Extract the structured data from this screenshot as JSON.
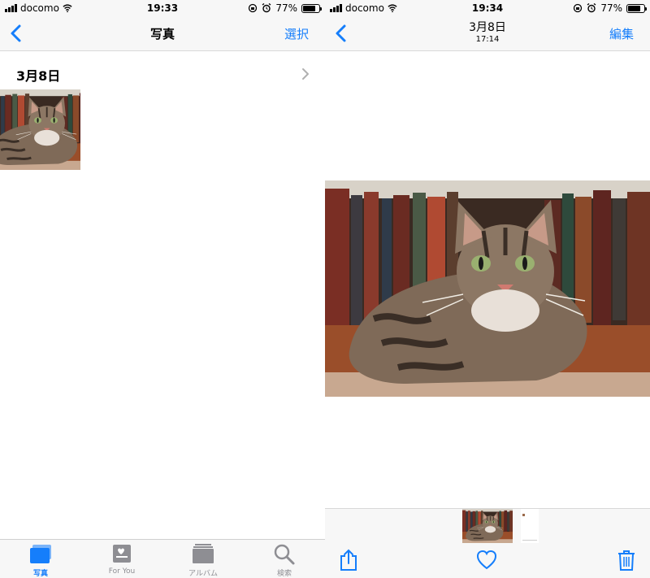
{
  "colors": {
    "accent": "#157efb",
    "bar_bg": "#f7f7f7",
    "inactive": "#8e8e93"
  },
  "left": {
    "status": {
      "carrier": "docomo",
      "time": "19:33",
      "battery": "77%",
      "battery_level": 0.77
    },
    "nav": {
      "back_icon": "chevron-left-icon",
      "title": "写真",
      "action": "選択"
    },
    "section": {
      "date": "3月8日",
      "chevron_icon": "chevron-right-icon"
    },
    "tabs": [
      {
        "label": "写真",
        "icon": "photos-icon",
        "active": true
      },
      {
        "label": "For You",
        "icon": "for-you-icon",
        "active": false
      },
      {
        "label": "アルバム",
        "icon": "albums-icon",
        "active": false
      },
      {
        "label": "検索",
        "icon": "search-icon",
        "active": false
      }
    ]
  },
  "right": {
    "status": {
      "carrier": "docomo",
      "time": "19:34",
      "battery": "77%",
      "battery_level": 0.77
    },
    "nav": {
      "back_icon": "chevron-left-icon",
      "title": "3月8日",
      "subtitle": "17:14",
      "action": "編集"
    },
    "toolbar": {
      "share_icon": "share-icon",
      "favorite_icon": "heart-icon",
      "delete_icon": "trash-icon"
    }
  }
}
